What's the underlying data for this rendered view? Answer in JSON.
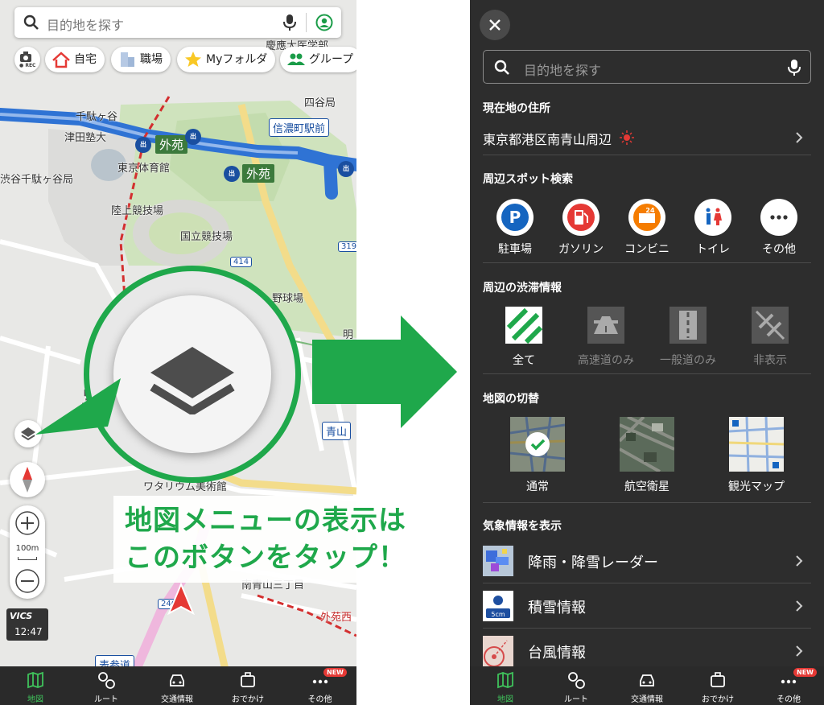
{
  "left": {
    "search": {
      "placeholder": "目的地を探す"
    },
    "chips": [
      {
        "label": "自宅",
        "icon": "home-icon"
      },
      {
        "label": "職場",
        "icon": "building-icon"
      },
      {
        "label": "Myフォルダ",
        "icon": "star-icon"
      },
      {
        "label": "グループ",
        "icon": "group-icon"
      }
    ],
    "rec_label": "● REC",
    "map_labels": {
      "sendagaya": "千駄ヶ谷",
      "tsuda": "津田塾大",
      "gaien_1": "外苑",
      "gaien_2": "外苑",
      "shinanomachi": "信濃町駅前",
      "yotsuya": "四谷局",
      "keio": "慶應大医学部",
      "tokyo_taiikukan": "東京体育館",
      "shibuya_sendagaya": "渋谷千駄ヶ谷局",
      "rikujo": "陸上競技場",
      "kokuritsu": "国立競技場",
      "route_414": "414",
      "route_319": "319",
      "baseball": "野球場",
      "mei": "明",
      "aoyama": "青山",
      "watarium": "ワタリウム美術館",
      "minami_aoyama": "南青山三丁目",
      "gaien_nishi": "外苑西",
      "omotesando": "表参道",
      "route_246": "246",
      "kanji_big": "署"
    },
    "scale": "100m",
    "vics": {
      "brand": "VICS",
      "time": "12:47"
    },
    "callout": {
      "line1": "地図メニューの表示は",
      "line2": "このボタンをタップ！"
    },
    "colors": {
      "accent": "#1fa84b",
      "nav_bg": "#2a2a2a",
      "active": "#3fc25b"
    }
  },
  "nav": [
    {
      "label": "地図",
      "icon": "map-icon",
      "active": true
    },
    {
      "label": "ルート",
      "icon": "route-icon"
    },
    {
      "label": "交通情報",
      "icon": "car-icon"
    },
    {
      "label": "おでかけ",
      "icon": "suitcase-icon"
    },
    {
      "label": "その他",
      "icon": "more-icon",
      "badge": "NEW"
    }
  ],
  "menu": {
    "search": {
      "placeholder": "目的地を探す"
    },
    "current_address": {
      "header": "現在地の住所",
      "value": "東京都港区南青山周辺"
    },
    "nearby": {
      "header": "周辺スポット検索",
      "items": [
        {
          "label": "駐車場",
          "icon": "parking-icon",
          "glyph": "P"
        },
        {
          "label": "ガソリン",
          "icon": "gas-station-icon"
        },
        {
          "label": "コンビニ",
          "icon": "convenience-store-icon",
          "glyph": "24"
        },
        {
          "label": "トイレ",
          "icon": "toilet-icon"
        },
        {
          "label": "その他",
          "icon": "more-icon",
          "glyph": "•••"
        }
      ]
    },
    "traffic": {
      "header": "周辺の渋滞情報",
      "items": [
        {
          "label": "全て",
          "icon": "traffic-all-icon",
          "selected": true
        },
        {
          "label": "高速道のみ",
          "icon": "expressway-icon"
        },
        {
          "label": "一般道のみ",
          "icon": "ordinary-road-icon"
        },
        {
          "label": "非表示",
          "icon": "traffic-hidden-icon"
        }
      ]
    },
    "map_switch": {
      "header": "地図の切替",
      "items": [
        {
          "label": "通常",
          "selected": true
        },
        {
          "label": "航空衛星"
        },
        {
          "label": "観光マップ"
        }
      ]
    },
    "weather": {
      "header": "気象情報を表示",
      "items": [
        {
          "label": "降雨・降雪レーダー",
          "icon": "rain-radar-icon"
        },
        {
          "label": "積雪情報",
          "icon": "snow-icon",
          "thumb_text": "5cm"
        },
        {
          "label": "台風情報",
          "icon": "typhoon-icon"
        }
      ]
    }
  }
}
